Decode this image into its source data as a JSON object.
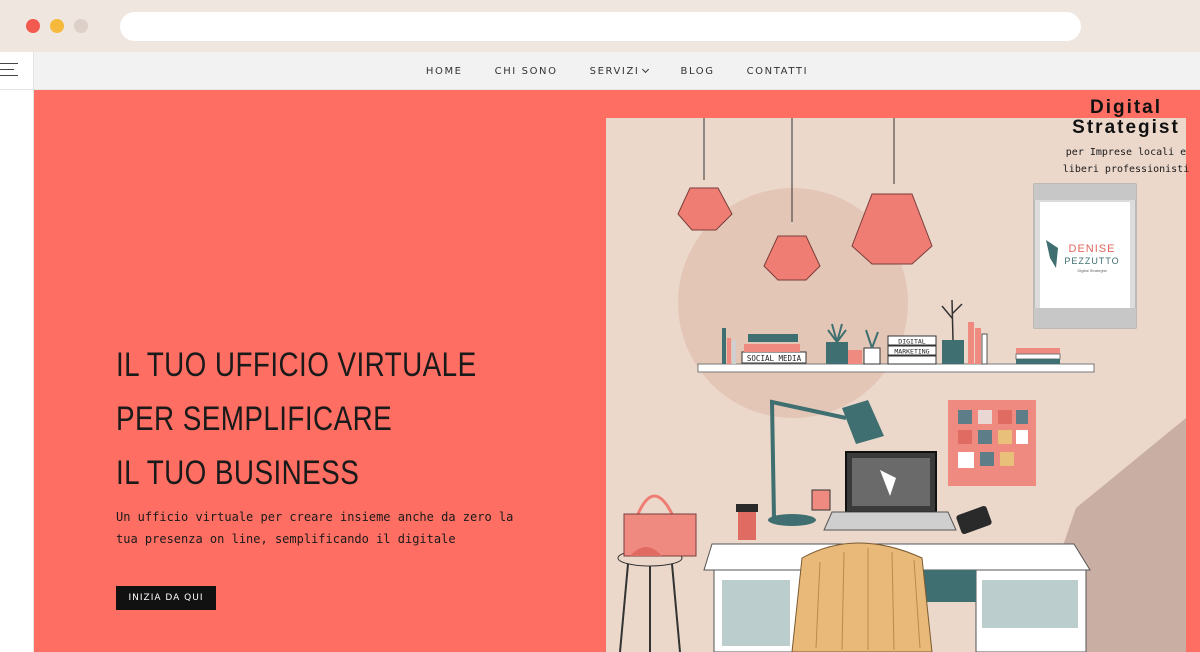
{
  "browser": {
    "dots": [
      "red",
      "yellow",
      "grey"
    ]
  },
  "nav": {
    "items": [
      "HOME",
      "CHI SONO",
      "SERVIZI",
      "BLOG",
      "CONTATTI"
    ]
  },
  "hero": {
    "headline": [
      "IL TUO UFFICIO VIRTUALE",
      "PER SEMPLIFICARE",
      "IL TUO BUSINESS"
    ],
    "subtitle": "Un ufficio virtuale per creare insieme anche da zero la tua presenza on line, semplificando il digitale",
    "cta_label": "INIZIA DA QUI"
  },
  "badge": {
    "title": "Digital Strategist",
    "subtitle": "per Imprese locali e liberi professionisti"
  },
  "illustration": {
    "frame_name_1": "DENISE",
    "frame_name_2": "PEZZUTTO",
    "frame_role": "Digital Strategist",
    "book_label_1": "SOCIAL MEDIA",
    "book_label_2": "DIGITAL",
    "book_label_3": "MARKETING"
  },
  "colors": {
    "hero_bg": "#ff6e62",
    "illustration_bg": "#ecd8cb",
    "accent_teal": "#3f6f70",
    "accent_pink": "#ef8a80"
  }
}
